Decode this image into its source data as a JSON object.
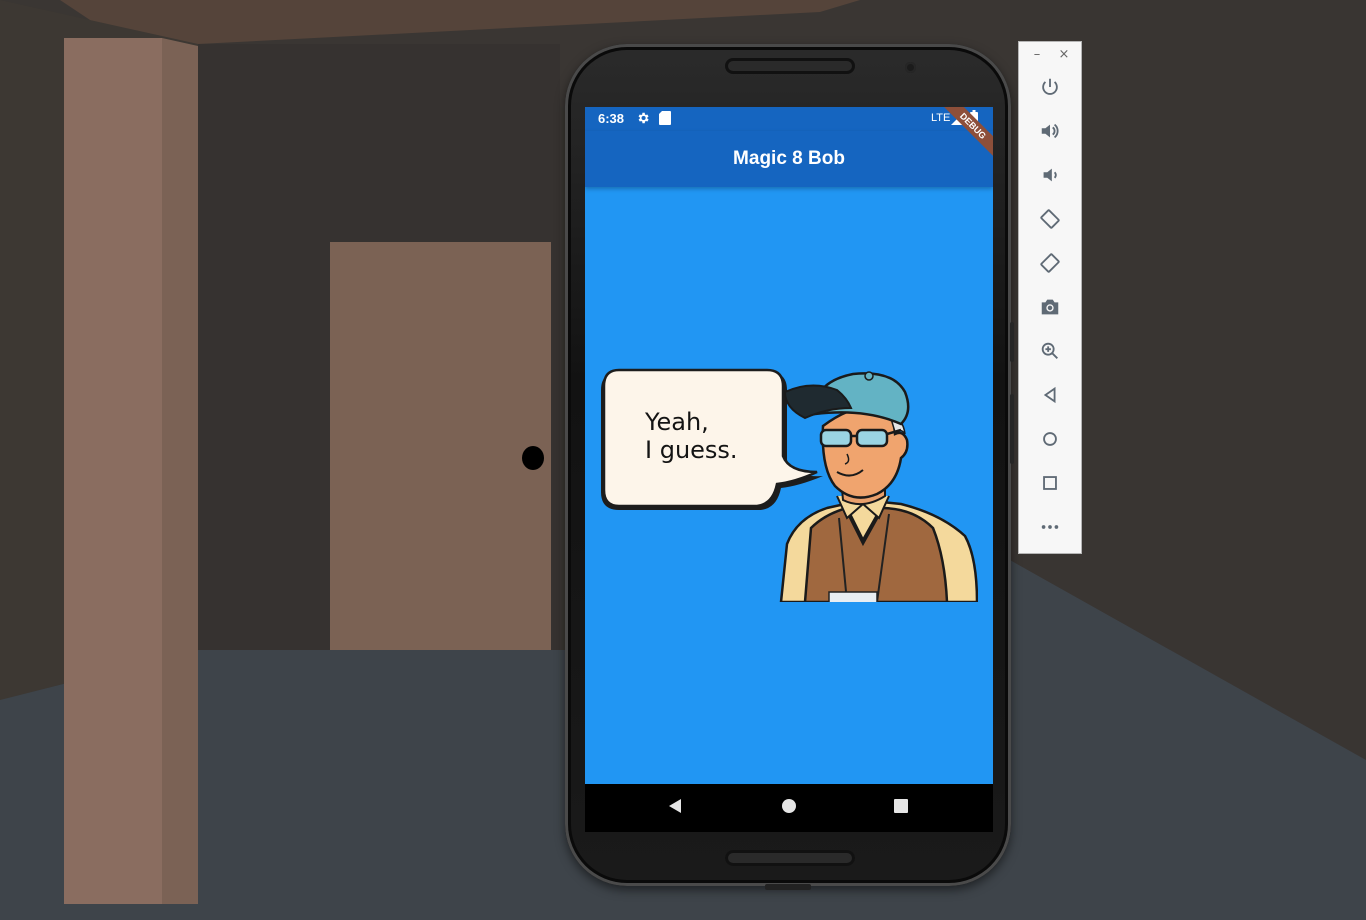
{
  "phone": {
    "status": {
      "time": "6:38",
      "network": "LTE"
    },
    "app_bar": {
      "title": "Magic 8 Bob"
    },
    "debug_banner": "DEBUG",
    "speech_bubble": {
      "text": "Yeah,\nI guess."
    },
    "colors": {
      "app_bar": "#1565c0",
      "background": "#2196f3",
      "nav_bar": "#000000"
    },
    "nav": [
      "back-icon",
      "home-icon",
      "recents-icon"
    ]
  },
  "toolbar": {
    "window_controls": [
      "minimize-icon",
      "close-icon"
    ],
    "buttons": [
      "power-icon",
      "volume-up-icon",
      "volume-down-icon",
      "rotate-left-icon",
      "rotate-right-icon",
      "camera-icon",
      "zoom-icon",
      "back-icon",
      "home-icon",
      "overview-icon",
      "more-icon"
    ]
  }
}
